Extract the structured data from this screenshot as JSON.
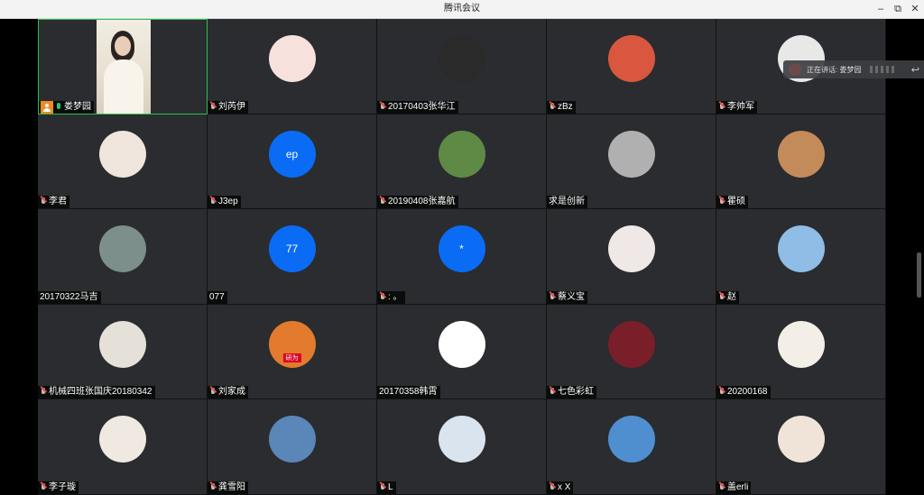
{
  "window": {
    "title": "腾讯会议",
    "controls": {
      "minimize": "–",
      "restore": "⧉",
      "close": "✕"
    }
  },
  "speaking_banner": {
    "text": "正在讲话: 娄梦园"
  },
  "colors": {
    "blue_avatar": "#0a6cf5",
    "active_border": "#27c24c",
    "host_badge": "#f08a24"
  },
  "participants": [
    {
      "name": "娄梦园",
      "mic": "on",
      "host": true,
      "video": true
    },
    {
      "name": "刘芮伊",
      "mic": "muted",
      "avatar_bg": "#f6e1dc",
      "avatar_icon": "cartoon-cat"
    },
    {
      "name": "20170403张华江",
      "mic": "muted",
      "avatar_bg": "#2a2a2a",
      "avatar_icon": "photo"
    },
    {
      "name": "zBz",
      "mic": "muted",
      "avatar_bg": "#d9573f",
      "avatar_icon": "orange-circle"
    },
    {
      "name": "李帅军",
      "mic": "muted",
      "avatar_bg": "#e8e8e8",
      "avatar_icon": "cartoon"
    },
    {
      "name": "李君",
      "mic": "muted",
      "avatar_bg": "#efe5dc",
      "avatar_icon": "photo"
    },
    {
      "name": "J3ep",
      "mic": "muted",
      "avatar_bg": "#0a6cf5",
      "avatar_text": "ep"
    },
    {
      "name": "20190408张嘉航",
      "mic": "muted",
      "avatar_bg": "#5f8a45",
      "avatar_icon": "photo"
    },
    {
      "name": "求是创新",
      "mic": "none",
      "avatar_bg": "#b0b0b0",
      "avatar_icon": "photo"
    },
    {
      "name": "瞿硕",
      "mic": "muted",
      "avatar_bg": "#c38a5a",
      "avatar_icon": "sunset"
    },
    {
      "name": "20170322马吉",
      "mic": "none",
      "avatar_bg": "#7c8f8a",
      "avatar_icon": "landscape"
    },
    {
      "name": "077",
      "mic": "none",
      "avatar_bg": "#0a6cf5",
      "avatar_text": "77"
    },
    {
      "name": ": 。",
      "mic": "muted",
      "avatar_bg": "#0a6cf5",
      "avatar_text": "*"
    },
    {
      "name": "蔡义宝",
      "mic": "muted",
      "avatar_bg": "#f0e7e7",
      "avatar_icon": "anime"
    },
    {
      "name": "赵",
      "mic": "muted",
      "avatar_bg": "#8fbde6",
      "avatar_icon": "astronaut"
    },
    {
      "name": "机械四班张国庆20180342",
      "mic": "muted",
      "avatar_bg": "#e6e1d8",
      "avatar_icon": "cartoon"
    },
    {
      "name": "刘家成",
      "mic": "muted",
      "avatar_bg": "#e27b2d",
      "avatar_icon": "photo",
      "avatar_caption": "研为"
    },
    {
      "name": "20170358韩霄",
      "mic": "none",
      "avatar_bg": "#ffffff",
      "avatar_icon": "doodle"
    },
    {
      "name": "七色彩虹",
      "mic": "muted",
      "avatar_bg": "#7a1e2a",
      "avatar_icon": "city-night"
    },
    {
      "name": "20200168",
      "mic": "muted",
      "avatar_bg": "#f3efe6",
      "avatar_icon": "painting"
    },
    {
      "name": "李子璇",
      "mic": "muted",
      "avatar_bg": "#efe9e2",
      "avatar_icon": "anime"
    },
    {
      "name": "龚雪阳",
      "mic": "muted",
      "avatar_bg": "#5a86b8",
      "avatar_icon": "photo"
    },
    {
      "name": "L",
      "mic": "muted",
      "avatar_bg": "#d9e4ef",
      "avatar_icon": "photo"
    },
    {
      "name": "x X",
      "mic": "muted",
      "avatar_bg": "#4f8fd0",
      "avatar_icon": "sky"
    },
    {
      "name": "盖erli",
      "mic": "muted",
      "avatar_bg": "#f0e4d8",
      "avatar_icon": "photo"
    }
  ]
}
